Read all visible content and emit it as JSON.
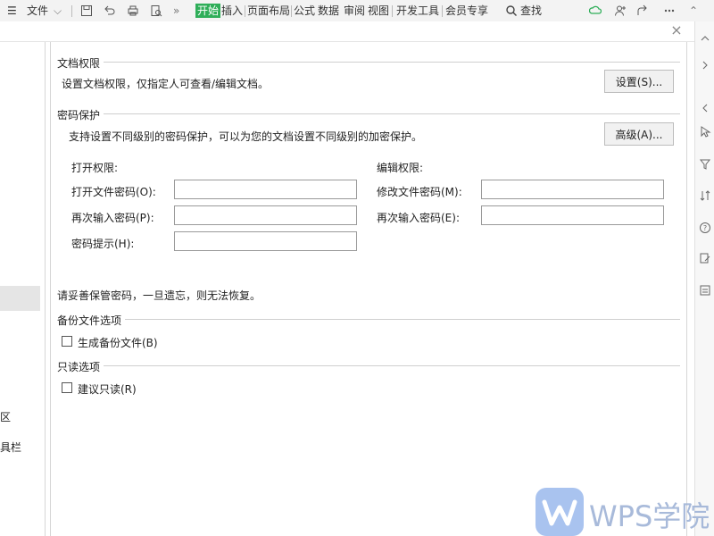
{
  "toolbar": {
    "menu_label": "文件",
    "tabs": [
      "开始",
      "插入",
      "页面布局",
      "公式",
      "数据",
      "审阅",
      "视图",
      "开发工具",
      "会员专享"
    ],
    "more": "»",
    "search_label": "查找"
  },
  "dialog": {
    "close_label": "×"
  },
  "left_nav": {
    "frag1": "区",
    "frag2": "具栏"
  },
  "doc_permission": {
    "title": "文档权限",
    "desc": "设置文档权限，仅指定人可查看/编辑文档。",
    "button": "设置(S)..."
  },
  "password": {
    "title": "密码保护",
    "desc": "支持设置不同级别的密码保护，可以为您的文档设置不同级别的加密保护。",
    "button": "高级(A)...",
    "open_group": "打开权限:",
    "open_password_label": "打开文件密码(O):",
    "open_password_value": "",
    "open_confirm_label": "再次输入密码(P):",
    "open_confirm_value": "",
    "hint_label": "密码提示(H):",
    "hint_value": "",
    "edit_group": "编辑权限:",
    "edit_password_label": "修改文件密码(M):",
    "edit_password_value": "",
    "edit_confirm_label": "再次输入密码(E):",
    "edit_confirm_value": "",
    "warning": "请妥善保管密码，一旦遗忘，则无法恢复。"
  },
  "backup": {
    "title": "备份文件选项",
    "checkbox_label": "生成备份文件(B)",
    "checked": false
  },
  "readonly": {
    "title": "只读选项",
    "checkbox_label": "建议只读(R)",
    "checked": false
  },
  "watermark": {
    "text": "WPS学院"
  },
  "colors": {
    "accent": "#2fae59",
    "border": "#9a9a9a",
    "watermark": "#9fb3d6"
  }
}
